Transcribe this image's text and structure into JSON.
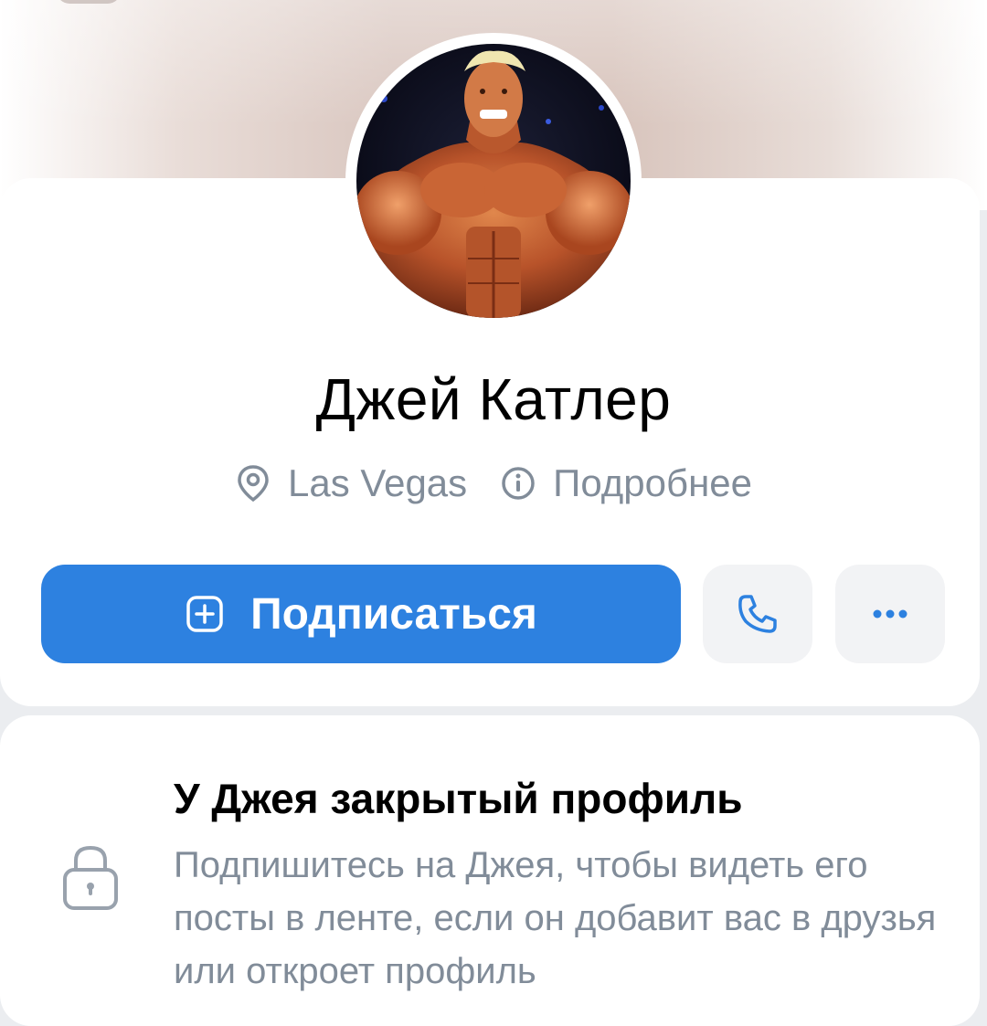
{
  "profile": {
    "name": "Джей Катлер",
    "location": "Las Vegas",
    "details_label": "Подробнее"
  },
  "actions": {
    "subscribe_label": "Подписаться",
    "call_icon": "phone-icon",
    "more_icon": "more-horizontal-icon"
  },
  "privacy": {
    "title": "У Джея закрытый профиль",
    "description": "Подпишитесь на Джея, чтобы видеть его посты в ленте, если он добавит вас в друзья или откроет профиль",
    "icon": "lock-icon"
  },
  "colors": {
    "accent": "#2d81e0",
    "secondary_text": "#818c99",
    "icon_button_bg": "#f2f3f5"
  }
}
